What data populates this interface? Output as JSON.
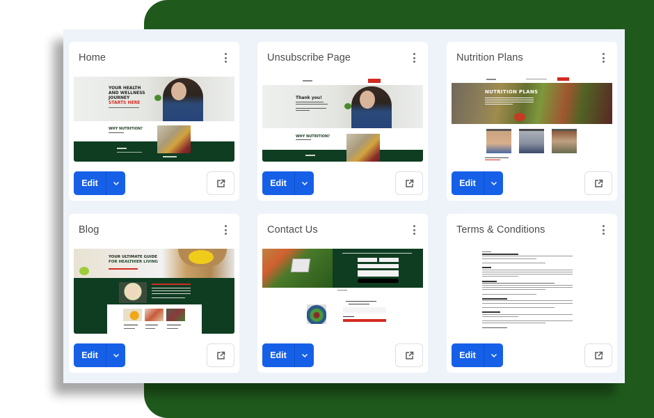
{
  "colors": {
    "background_green": "#1f5a1c",
    "panel": "#eef3f9",
    "primary_button": "#1660e8",
    "site_dark_green": "#0f3d22",
    "site_accent_red": "#d42a20"
  },
  "pages": [
    {
      "title": "Home",
      "thumbnail": {
        "hero_lines": [
          "YOUR HEALTH",
          "AND WELLNESS",
          "JOURNEY"
        ],
        "hero_accent": "STARTS HERE",
        "section_heading": "WHY NUTRITION?"
      },
      "edit_label": "Edit",
      "icons": {
        "menu": "kebab-menu-icon",
        "dropdown": "chevron-down-icon",
        "open": "external-link-icon"
      }
    },
    {
      "title": "Unsubscribe Page",
      "thumbnail": {
        "hero_heading": "Thank you!",
        "section_heading": "WHY NUTRITION?"
      },
      "edit_label": "Edit",
      "icons": {
        "menu": "kebab-menu-icon",
        "dropdown": "chevron-down-icon",
        "open": "external-link-icon"
      }
    },
    {
      "title": "Nutrition Plans",
      "thumbnail": {
        "hero_heading": "NUTRITION PLANS"
      },
      "edit_label": "Edit",
      "icons": {
        "menu": "kebab-menu-icon",
        "dropdown": "chevron-down-icon",
        "open": "external-link-icon"
      }
    },
    {
      "title": "Blog",
      "thumbnail": {
        "hero_lines": [
          "YOUR ULTIMATE GUIDE",
          "FOR HEALTHIER LIVING"
        ]
      },
      "edit_label": "Edit",
      "icons": {
        "menu": "kebab-menu-icon",
        "dropdown": "chevron-down-icon",
        "open": "external-link-icon"
      }
    },
    {
      "title": "Contact Us",
      "thumbnail": {},
      "edit_label": "Edit",
      "icons": {
        "menu": "kebab-menu-icon",
        "dropdown": "chevron-down-icon",
        "open": "external-link-icon"
      }
    },
    {
      "title": "Terms & Conditions",
      "thumbnail": {},
      "edit_label": "Edit",
      "icons": {
        "menu": "kebab-menu-icon",
        "dropdown": "chevron-down-icon",
        "open": "external-link-icon"
      }
    }
  ]
}
